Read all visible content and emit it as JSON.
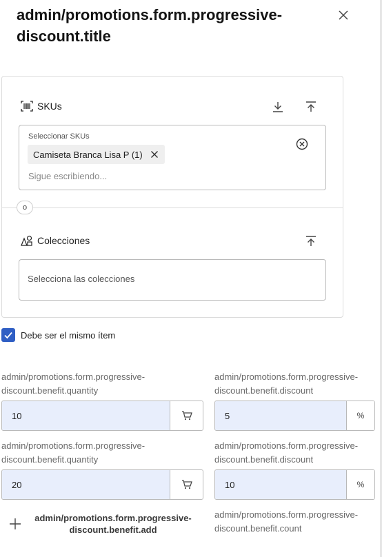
{
  "header": {
    "title": "admin/promotions.form.progressive-discount.title"
  },
  "skus": {
    "heading": "SKUs",
    "field_label": "Seleccionar SKUs",
    "chip": "Camiseta Branca Lisa P (1)",
    "placeholder": "Sigue escribiendo..."
  },
  "or_label": "o",
  "collections": {
    "heading": "Colecciones",
    "placeholder": "Selecciona las colecciones"
  },
  "same_item": {
    "label": "Debe ser el mismo ítem",
    "checked": true
  },
  "tiers": [
    {
      "quantity_label": "admin/promotions.form.progressive-discount.benefit.quantity",
      "quantity": "10",
      "discount_label": "admin/promotions.form.progressive-discount.benefit.discount",
      "discount": "5"
    },
    {
      "quantity_label": "admin/promotions.form.progressive-discount.benefit.quantity",
      "quantity": "20",
      "discount_label": "admin/promotions.form.progressive-discount.benefit.discount",
      "discount": "10"
    }
  ],
  "percent_symbol": "%",
  "add_label": "admin/promotions.form.progressive-discount.benefit.add",
  "count_label": "admin/promotions.form.progressive-discount.benefit.count",
  "colors": {
    "accent": "#2f5ec4",
    "input_fill": "#e8eefc",
    "border": "#b9b9b9"
  },
  "icons": {
    "close": "close-icon",
    "barcode": "barcode-icon",
    "download": "download-icon",
    "upload": "upload-icon",
    "shapes": "shapes-icon",
    "cart": "cart-icon",
    "plus": "plus-icon"
  }
}
